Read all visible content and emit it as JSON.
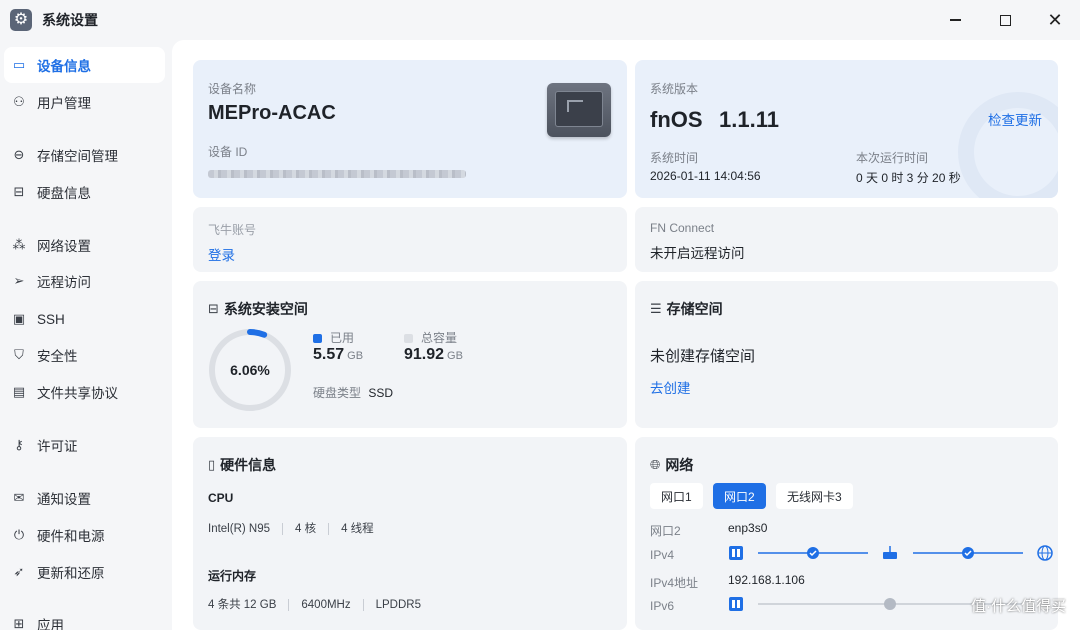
{
  "app": {
    "title": "系统设置"
  },
  "sidebar": {
    "items": [
      {
        "label": "设备信息",
        "icon": "monitor-icon"
      },
      {
        "label": "用户管理",
        "icon": "users-icon"
      },
      {
        "label": "存储空间管理",
        "icon": "storage-icon"
      },
      {
        "label": "硬盘信息",
        "icon": "disk-icon"
      },
      {
        "label": "网络设置",
        "icon": "network-icon"
      },
      {
        "label": "远程访问",
        "icon": "send-icon"
      },
      {
        "label": "SSH",
        "icon": "terminal-icon"
      },
      {
        "label": "安全性",
        "icon": "shield-icon"
      },
      {
        "label": "文件共享协议",
        "icon": "file-icon"
      },
      {
        "label": "许可证",
        "icon": "key-icon"
      },
      {
        "label": "通知设置",
        "icon": "mail-icon"
      },
      {
        "label": "硬件和电源",
        "icon": "power-icon"
      },
      {
        "label": "更新和还原",
        "icon": "rocket-icon"
      },
      {
        "label": "应用",
        "icon": "apps-icon"
      }
    ]
  },
  "device": {
    "name_label": "设备名称",
    "name": "MEPro-ACAC",
    "id_label": "设备 ID"
  },
  "system": {
    "version_label": "系统版本",
    "os": "fnOS",
    "version": "1.1.11",
    "check_update": "检查更新",
    "time_label": "系统时间",
    "time": "2026-01-11 14:04:56",
    "uptime_label": "本次运行时间",
    "uptime": "0 天 0 时 3 分 20 秒"
  },
  "account": {
    "label": "飞牛账号",
    "login": "登录"
  },
  "fn_connect": {
    "label": "FN Connect",
    "status": "未开启远程访问"
  },
  "system_space": {
    "title": "系统安装空间",
    "percent": "6.06%",
    "used_fraction": 0.0606,
    "used_label": "已用",
    "used_value": "5.57",
    "used_unit": "GB",
    "total_label": "总容量",
    "total_value": "91.92",
    "total_unit": "GB",
    "disk_type_label": "硬盘类型",
    "disk_type": "SSD"
  },
  "storage": {
    "title": "存储空间",
    "status": "未创建存储空间",
    "create": "去创建"
  },
  "hardware": {
    "title": "硬件信息",
    "cpu_label": "CPU",
    "cpu_model": "Intel(R) N95",
    "cpu_cores": "4 核",
    "cpu_threads": "4 线程",
    "mem_label": "运行内存",
    "mem_slots": "4 条共 12 GB",
    "mem_freq": "6400MHz",
    "mem_type": "LPDDR5"
  },
  "network": {
    "title": "网络",
    "tabs": [
      "网口1",
      "网口2",
      "无线网卡3"
    ],
    "active_tab": 1,
    "iface_label": "网口2",
    "iface": "enp3s0",
    "ipv4_label": "IPv4",
    "ipv4_addr_label": "IPv4地址",
    "ipv4_addr": "192.168.1.106",
    "ipv6_label": "IPv6"
  },
  "watermark": "值·什么值得买",
  "colors": {
    "accent": "#1f6fe5",
    "card": "#f2f4f7",
    "card_blue": "#e9f0fa"
  }
}
